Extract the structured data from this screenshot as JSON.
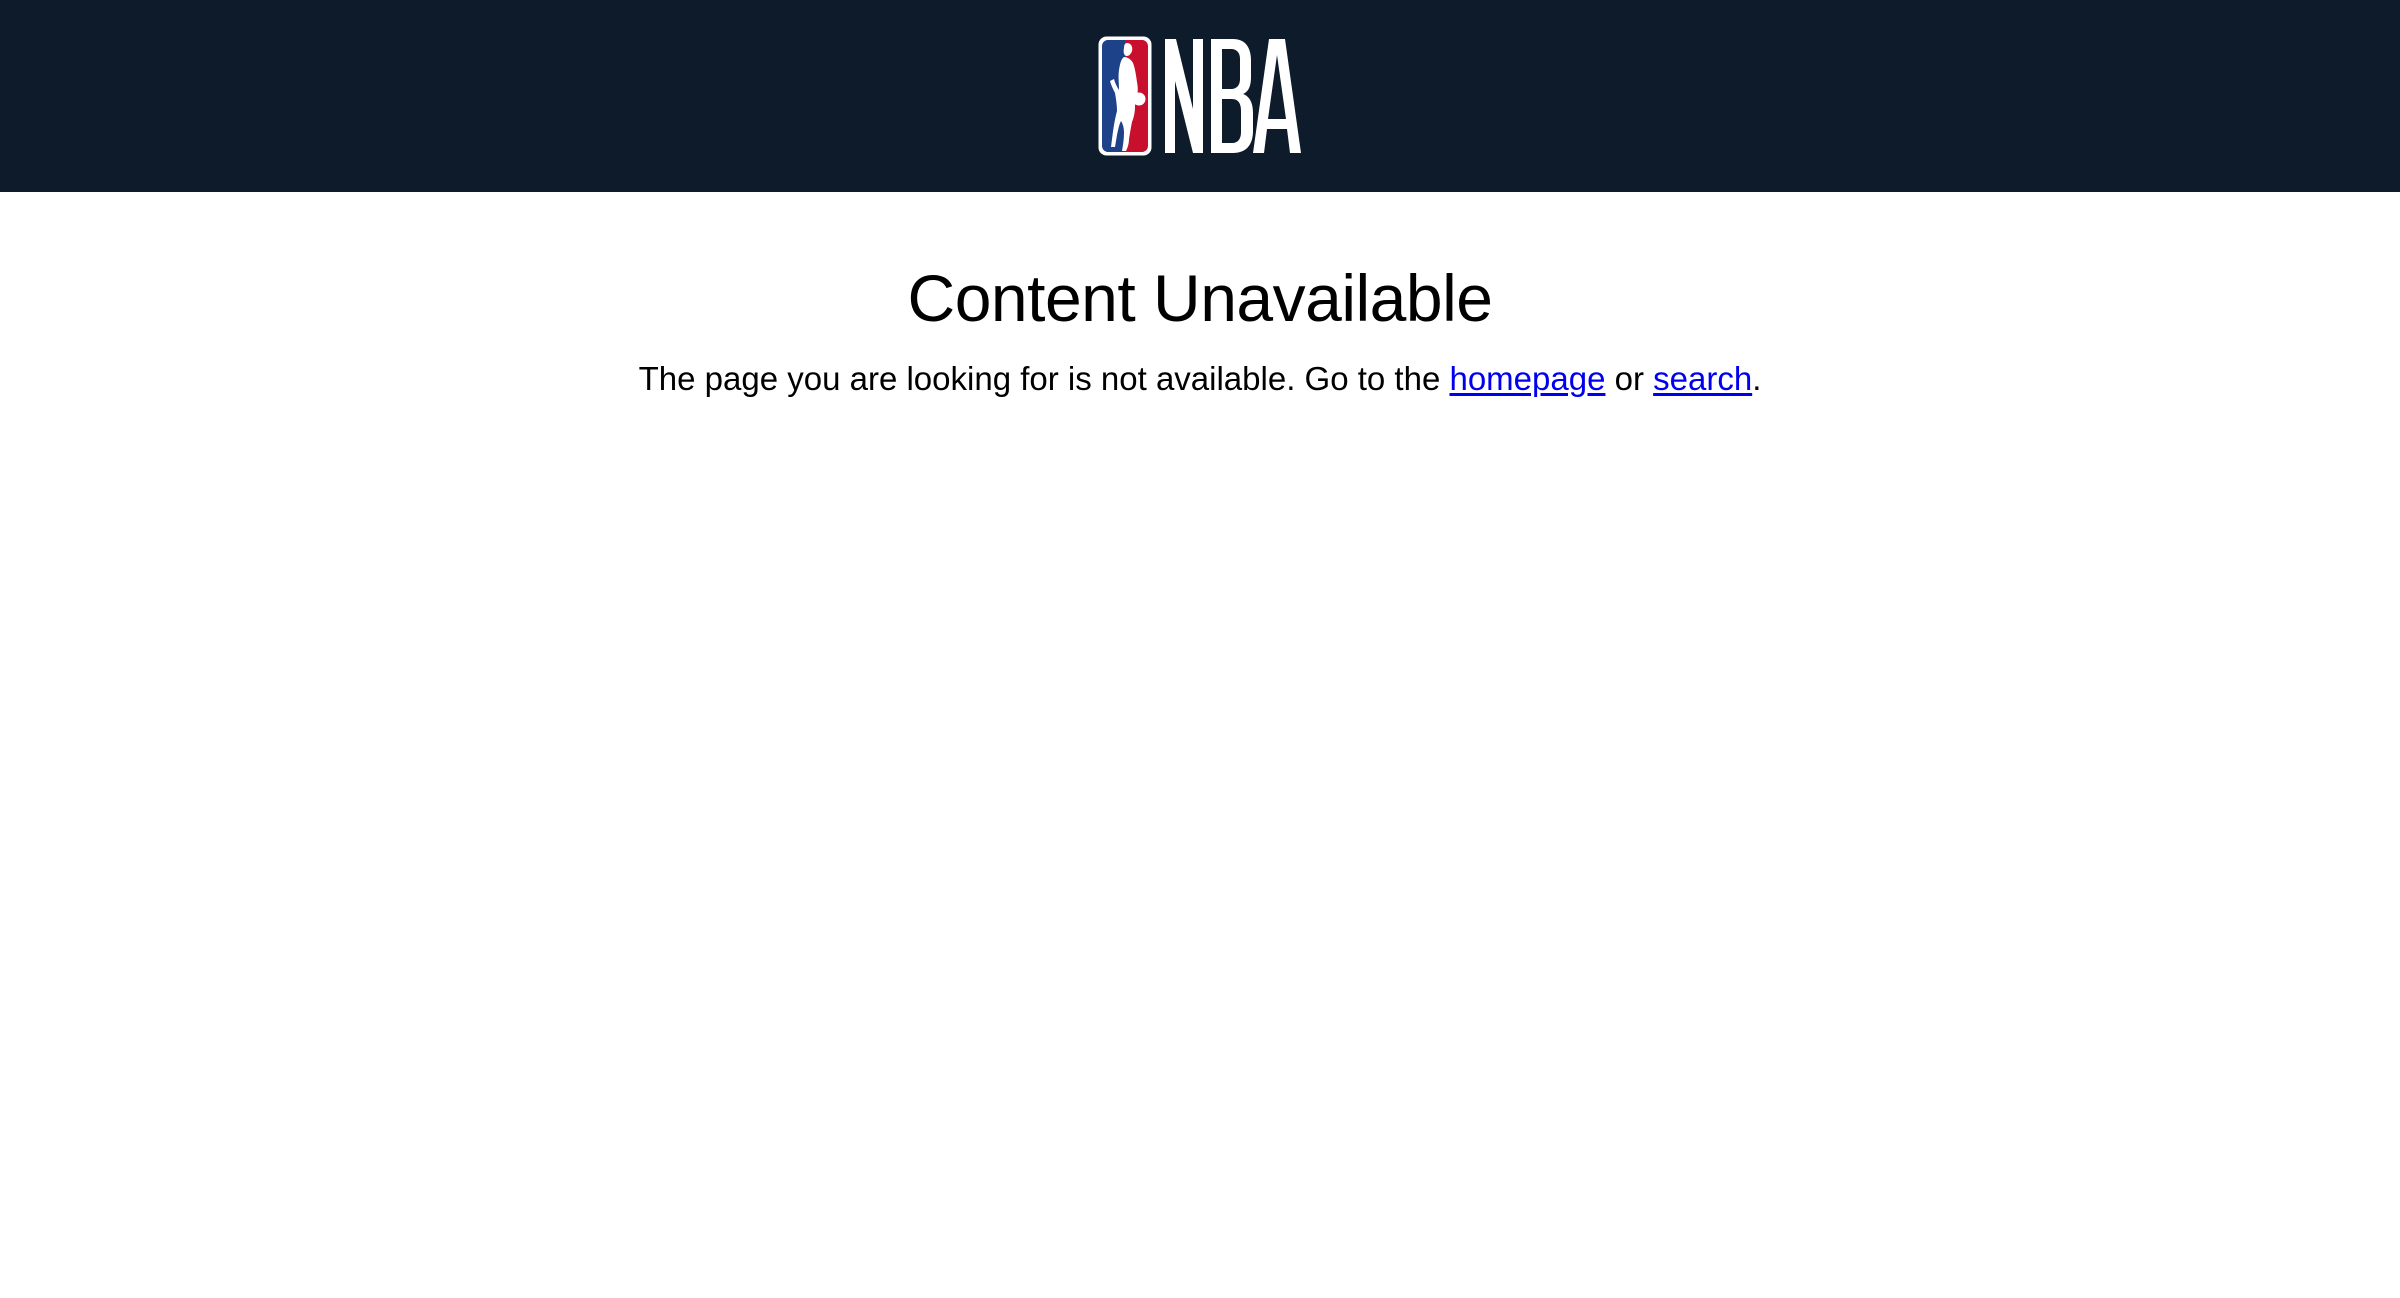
{
  "header": {
    "logo_text": "NBA",
    "logo_icon": "nba-logo-icon",
    "colors": {
      "background": "#0d1b2a",
      "logo_blue": "#1d428a",
      "logo_red": "#c8102e"
    }
  },
  "main": {
    "title": "Content Unavailable",
    "message_prefix": "The page you are looking for is not available. Go to the ",
    "homepage_link": "homepage",
    "message_middle": " or ",
    "search_link": "search",
    "message_suffix": "."
  },
  "colors": {
    "link": "#0000ee",
    "text": "#000000",
    "page_background": "#ffffff"
  }
}
